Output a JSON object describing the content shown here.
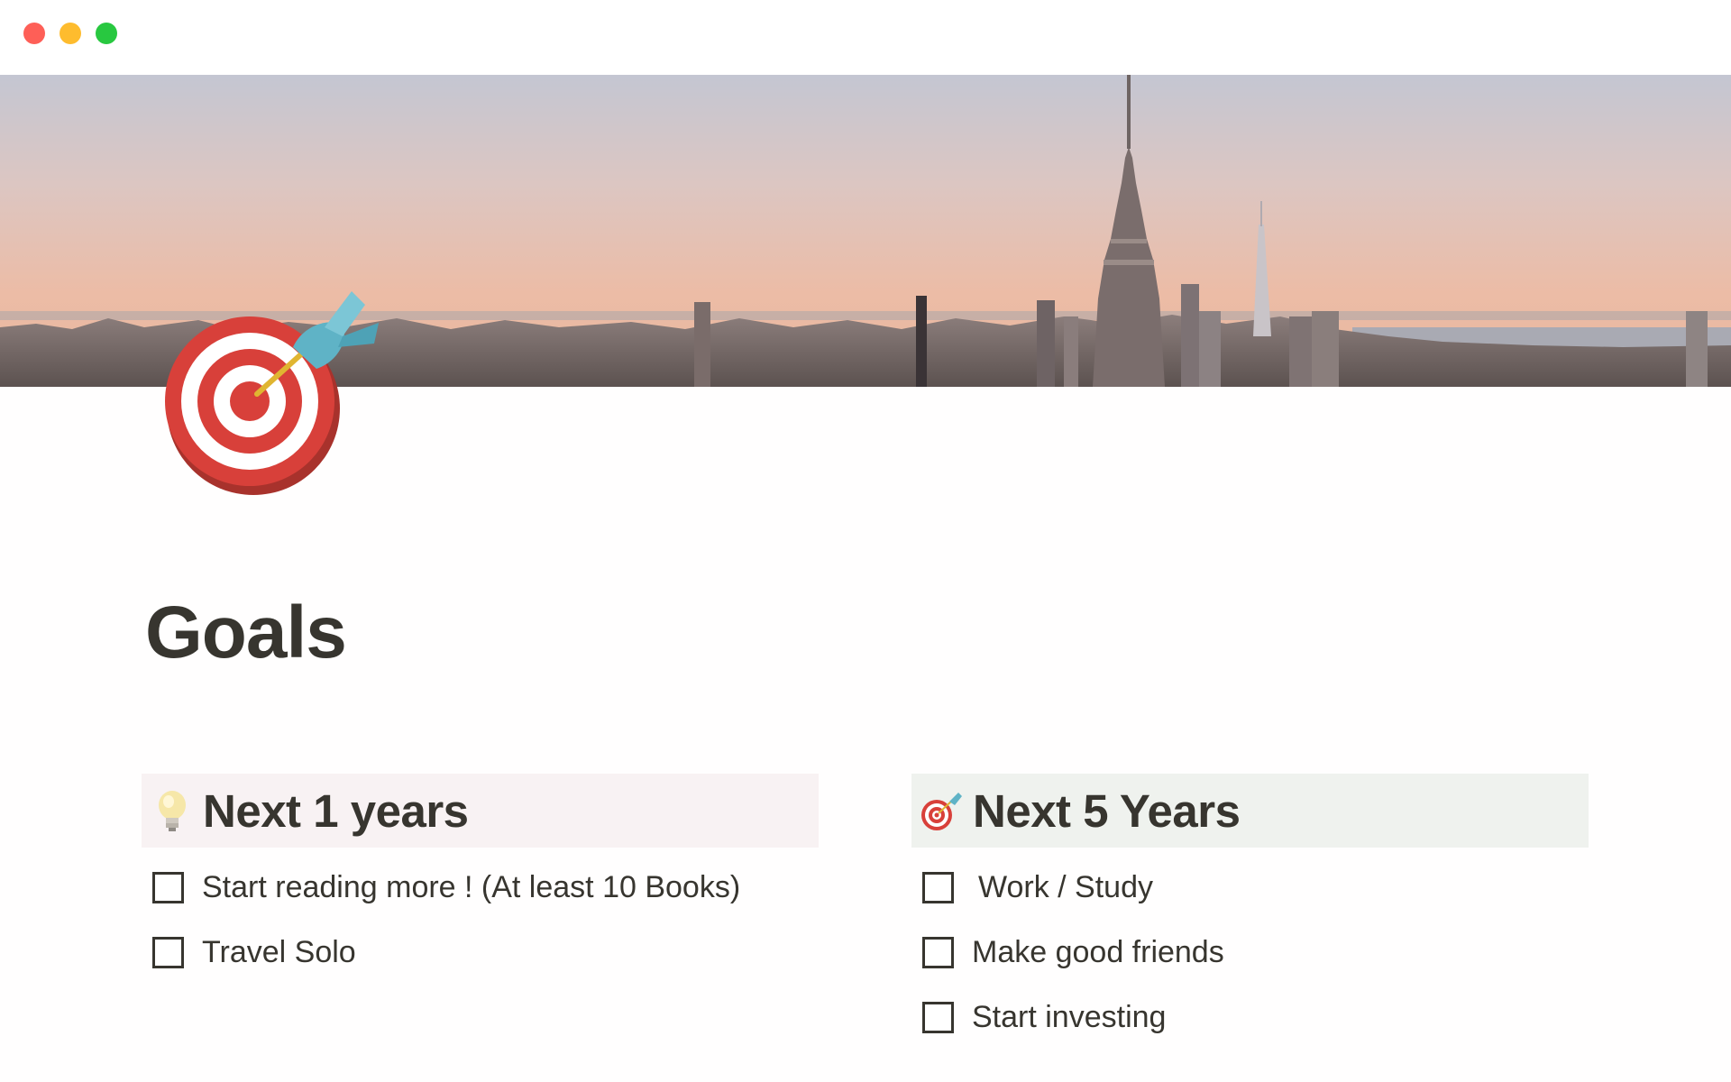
{
  "window": {
    "buttons": [
      "close",
      "minimize",
      "maximize"
    ]
  },
  "cover": {
    "description_icon": "new-york-skyline-cover"
  },
  "page": {
    "icon": "direct-hit-icon",
    "title": "Goals"
  },
  "columns": [
    {
      "heading": "Next 1 years",
      "heading_icon": "light-bulb-icon",
      "heading_bg": "#f8f2f3",
      "todos": [
        {
          "label": "Start reading more ! (At least 10 Books)",
          "checked": false
        },
        {
          "label": "Travel Solo",
          "checked": false
        }
      ]
    },
    {
      "heading": "Next 5 Years",
      "heading_icon": "direct-hit-icon",
      "heading_bg": "#eff2ee",
      "todos": [
        {
          "label": "Work / Study",
          "checked": false
        },
        {
          "label": "Make good friends",
          "checked": false
        },
        {
          "label": "Start investing",
          "checked": false
        }
      ]
    }
  ],
  "colors": {
    "close": "#fe5f57",
    "minimize": "#febc2e",
    "maximize": "#28c840",
    "text": "#37352f"
  }
}
